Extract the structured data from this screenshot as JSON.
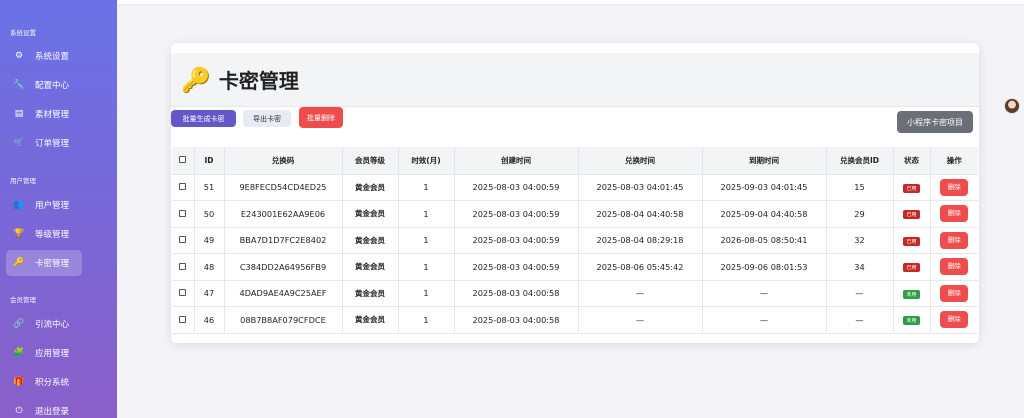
{
  "sidebar": {
    "sections": [
      {
        "label": "系统设置",
        "items": [
          {
            "label": "系统设置",
            "icon": "gear-icon"
          },
          {
            "label": "配置中心",
            "icon": "wrench-icon"
          },
          {
            "label": "素材管理",
            "icon": "file-icon"
          },
          {
            "label": "订单管理",
            "icon": "cart-icon"
          }
        ]
      },
      {
        "label": "用户管理",
        "items": [
          {
            "label": "用户管理",
            "icon": "users-icon"
          },
          {
            "label": "等级管理",
            "icon": "trophy-icon"
          },
          {
            "label": "卡密管理",
            "icon": "key-icon",
            "active": true
          }
        ]
      },
      {
        "label": "会员管理",
        "items": [
          {
            "label": "引流中心",
            "icon": "link-icon"
          },
          {
            "label": "应用管理",
            "icon": "puzzle-icon"
          },
          {
            "label": "积分系统",
            "icon": "gift-icon"
          },
          {
            "label": "退出登录",
            "icon": "logout-icon"
          }
        ]
      }
    ]
  },
  "page": {
    "title": "卡密管理"
  },
  "toolbar": {
    "generate_label": "批量生成卡密",
    "export_label": "导出卡密",
    "delete_label": "批量删除",
    "mini_label": "小程序卡密项目"
  },
  "table": {
    "columns": [
      "ID",
      "兑换码",
      "会员等级",
      "时效(月)",
      "创建时间",
      "兑换时间",
      "到期时间",
      "兑换会员ID",
      "状态",
      "操作"
    ],
    "rows": [
      {
        "id": "51",
        "code": "9E8FECD54CD4ED25",
        "level": "黄金会员",
        "months": "1",
        "created": "2025-08-03 04:00:59",
        "redeemed": "2025-08-03 04:01:45",
        "expires": "2025-09-03 04:01:45",
        "member_id": "15",
        "status": "已用",
        "status_type": "used",
        "action": "删除"
      },
      {
        "id": "50",
        "code": "E243001E62AA9E06",
        "level": "黄金会员",
        "months": "1",
        "created": "2025-08-03 04:00:59",
        "redeemed": "2025-08-04 04:40:58",
        "expires": "2025-09-04 04:40:58",
        "member_id": "29",
        "status": "已用",
        "status_type": "used",
        "action": "删除"
      },
      {
        "id": "49",
        "code": "BBA7D1D7FC2E8402",
        "level": "黄金会员",
        "months": "1",
        "created": "2025-08-03 04:00:59",
        "redeemed": "2025-08-04 08:29:18",
        "expires": "2026-08-05 08:50:41",
        "member_id": "32",
        "status": "已用",
        "status_type": "used",
        "action": "删除"
      },
      {
        "id": "48",
        "code": "C384DD2A64956FB9",
        "level": "黄金会员",
        "months": "1",
        "created": "2025-08-03 04:00:59",
        "redeemed": "2025-08-06 05:45:42",
        "expires": "2025-09-06 08:01:53",
        "member_id": "34",
        "status": "已用",
        "status_type": "used",
        "action": "删除"
      },
      {
        "id": "47",
        "code": "4DAD9AE4A9C25AEF",
        "level": "黄金会员",
        "months": "1",
        "created": "2025-08-03 04:00:58",
        "redeemed": "—",
        "expires": "—",
        "member_id": "—",
        "status": "未用",
        "status_type": "unused",
        "action": "删除"
      },
      {
        "id": "46",
        "code": "08B7B8AF079CFDCE",
        "level": "黄金会员",
        "months": "1",
        "created": "2025-08-03 04:00:58",
        "redeemed": "—",
        "expires": "—",
        "member_id": "—",
        "status": "未用",
        "status_type": "unused",
        "action": "删除"
      }
    ]
  },
  "colors": {
    "sidebar_top": "#6a72e6",
    "sidebar_bottom": "#8a5fc9",
    "danger": "#ef4d4d",
    "primary": "#6457c9",
    "used": "#c62828",
    "unused": "#2e9d44"
  }
}
